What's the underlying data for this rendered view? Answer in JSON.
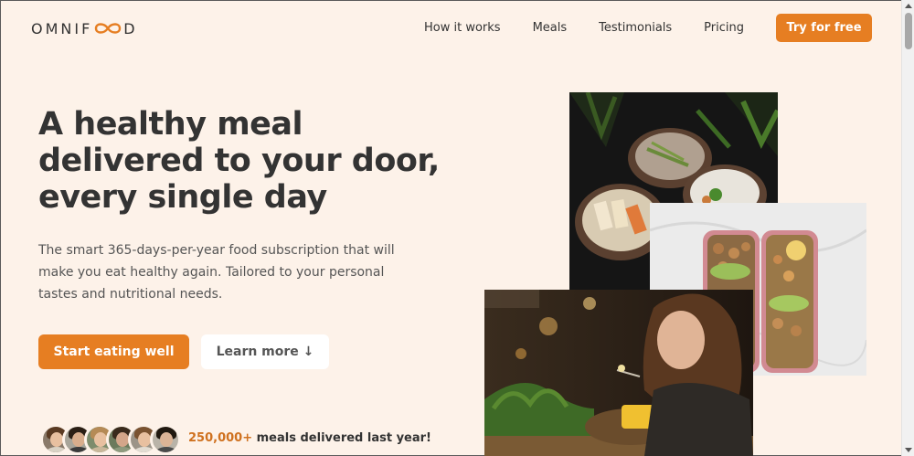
{
  "header": {
    "logo_left": "OMNIF",
    "logo_right": "D",
    "nav": [
      "How it works",
      "Meals",
      "Testimonials",
      "Pricing"
    ],
    "cta": "Try for free"
  },
  "hero": {
    "title_line1": "A healthy meal",
    "title_line2": "delivered to your door,",
    "title_line3": "every single day",
    "description": "The smart 365-days-per-year food subscription that will make you eat healthy again. Tailored to your personal tastes and nutritional needs.",
    "primary_button": "Start eating well",
    "secondary_button": "Learn more ↓",
    "delivered_count": "250,000+",
    "delivered_text": "meals delivered last year!"
  },
  "colors": {
    "accent": "#e67e22",
    "background": "#fdf2e9",
    "text": "#333333"
  },
  "icons": [
    "infinity-logo-icon",
    "scroll-up-icon",
    "scroll-down-icon"
  ]
}
